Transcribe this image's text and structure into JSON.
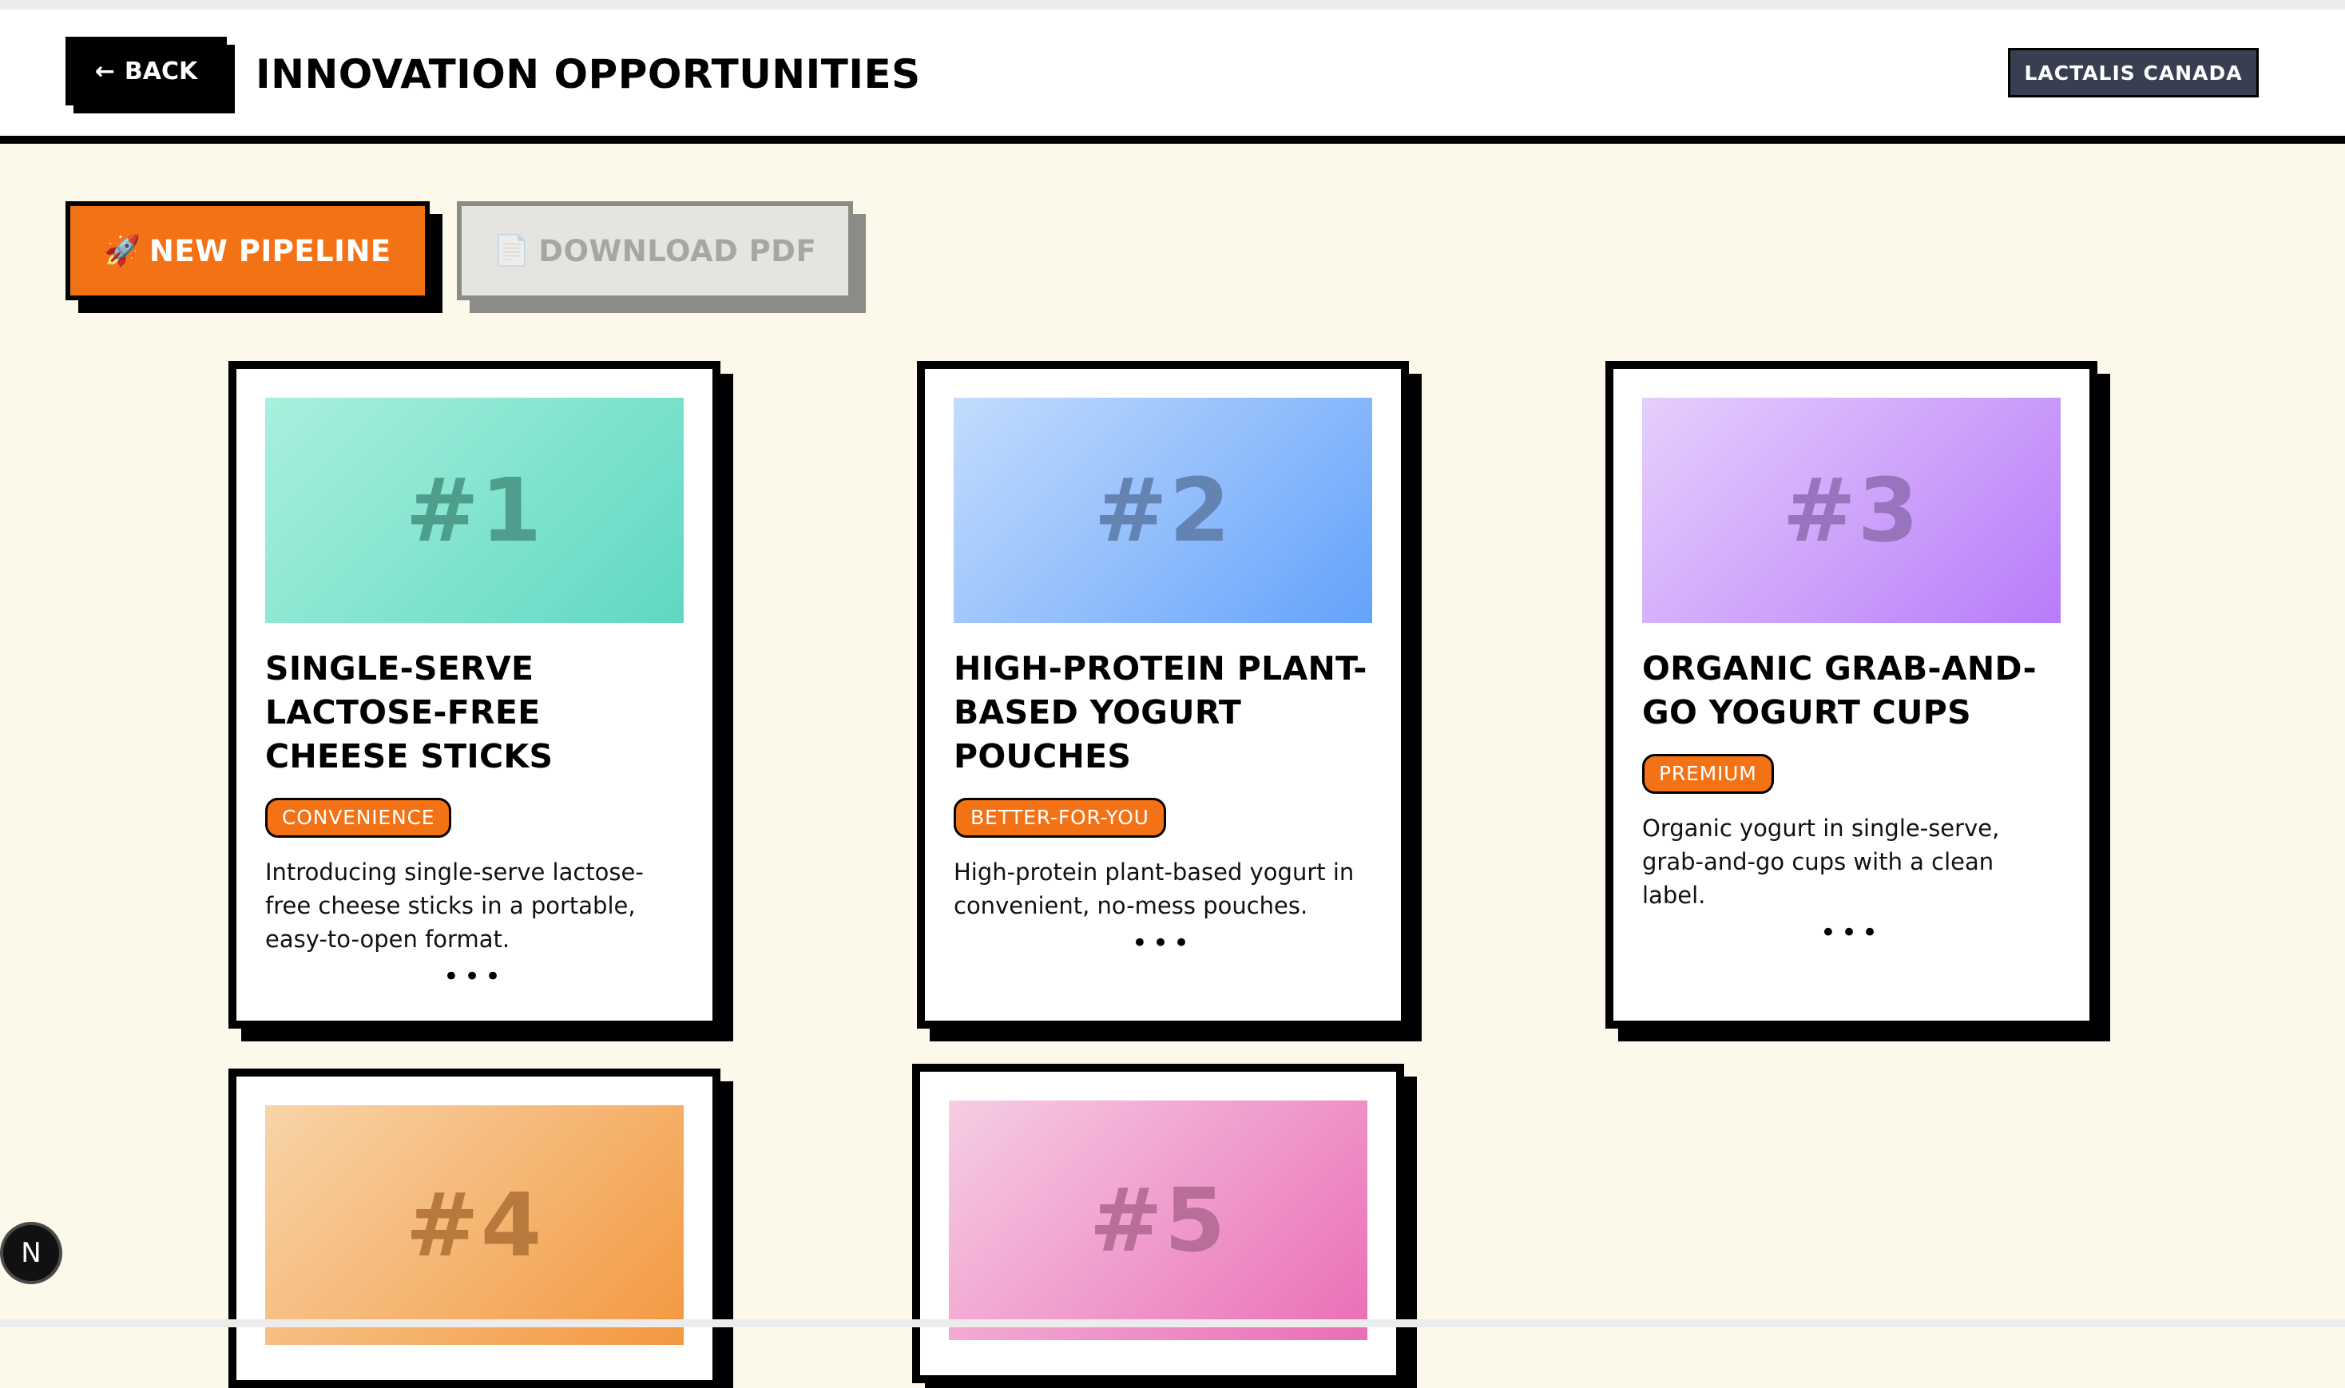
{
  "header": {
    "back_label": "BACK",
    "back_icon": "arrow-left-icon",
    "title": "INNOVATION OPPORTUNITIES",
    "company": "LACTALIS CANADA"
  },
  "actions": {
    "new_pipeline_label": "NEW PIPELINE",
    "new_pipeline_icon": "🚀",
    "download_pdf_label": "DOWNLOAD PDF",
    "download_pdf_icon": "📄"
  },
  "colors": {
    "background": "#fcf9eb",
    "accent": "#f47216",
    "badge_bg": "#373f51",
    "disabled": "#e5e4e1"
  },
  "cards": [
    {
      "rank": "#1",
      "title": "SINGLE-SERVE LACTOSE-FREE CHEESE STICKS",
      "tag": "CONVENIENCE",
      "description": "Introducing single-serve lactose-free cheese sticks in a portable, easy-to-open format.",
      "more": "•••",
      "gradient": [
        "#a8f0de",
        "#5fd8c1"
      ],
      "rank_color": "#4d9e8d"
    },
    {
      "rank": "#2",
      "title": "HIGH-PROTEIN PLANT-BASED YOGURT POUCHES",
      "tag": "BETTER-FOR-YOU",
      "description": "High-protein plant-based yogurt in convenient, no-mess pouches.",
      "more": "•••",
      "gradient": [
        "#c3dcfd",
        "#64a2fb"
      ],
      "rank_color": "#6384b3"
    },
    {
      "rank": "#3",
      "title": "ORGANIC GRAB-AND-GO YOGURT CUPS",
      "tag": "PREMIUM",
      "description": "Organic yogurt in single-serve, grab-and-go cups with a clean label.",
      "more": "•••",
      "gradient": [
        "#e5cffc",
        "#b87bfa"
      ],
      "rank_color": "#9774bb"
    },
    {
      "rank": "#4",
      "gradient": [
        "#f8d4a8",
        "#f3983f"
      ],
      "rank_color": "#b9793d"
    },
    {
      "rank": "#5",
      "gradient": [
        "#f6cde4",
        "#ea6db5"
      ],
      "rank_color": "#b86e98"
    }
  ]
}
